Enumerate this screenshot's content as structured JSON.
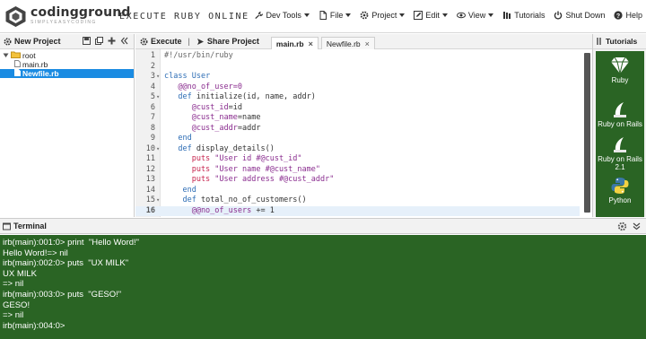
{
  "header": {
    "brand": "codingground",
    "brand_sub": "SIMPLYEASYCODING",
    "tagline": "EXECUTE RUBY ONLINE",
    "nav": [
      {
        "label": "Dev Tools",
        "icon": "wrench-icon",
        "has_caret": true
      },
      {
        "label": "File",
        "icon": "file-icon",
        "has_caret": true
      },
      {
        "label": "Project",
        "icon": "gear-icon",
        "has_caret": true
      },
      {
        "label": "Edit",
        "icon": "pencil-icon",
        "has_caret": true
      },
      {
        "label": "View",
        "icon": "eye-icon",
        "has_caret": true
      },
      {
        "label": "Tutorials",
        "icon": "tutorials-icon",
        "has_caret": false
      },
      {
        "label": "Shut Down",
        "icon": "power-icon",
        "has_caret": false
      },
      {
        "label": "Help",
        "icon": "help-icon",
        "has_caret": false
      }
    ]
  },
  "project": {
    "new_project_label": "New Project",
    "tree": [
      {
        "label": "root",
        "type": "folder",
        "depth": 0,
        "selected": false
      },
      {
        "label": "main.rb",
        "type": "file",
        "depth": 1,
        "selected": false
      },
      {
        "label": "Newfile.rb",
        "type": "file",
        "depth": 1,
        "selected": true
      }
    ]
  },
  "editor": {
    "execute_label": "Execute",
    "separator": "|",
    "share_label": "Share Project",
    "tabs": [
      {
        "label": "main.rb",
        "active": true
      },
      {
        "label": "Newfile.rb",
        "active": false
      }
    ],
    "active_line": 16,
    "lines": [
      {
        "n": "1",
        "fold": "",
        "tokens": [
          {
            "t": "#!/usr/bin/ruby",
            "c": "gray"
          }
        ]
      },
      {
        "n": "2",
        "fold": "",
        "tokens": []
      },
      {
        "n": "3",
        "fold": "▾",
        "tokens": [
          {
            "t": "class ",
            "c": "blue"
          },
          {
            "t": "User",
            "c": "blue"
          }
        ]
      },
      {
        "n": "4",
        "fold": "",
        "tokens": [
          {
            "t": "   @@no_of_user=0",
            "c": "purple"
          }
        ]
      },
      {
        "n": "5",
        "fold": "▾",
        "tokens": [
          {
            "t": "   def ",
            "c": "blue"
          },
          {
            "t": "initialize(id, name, addr)",
            "c": "dark"
          }
        ]
      },
      {
        "n": "6",
        "fold": "",
        "tokens": [
          {
            "t": "      @cust_id",
            "c": "purple"
          },
          {
            "t": "=id",
            "c": "dark"
          }
        ]
      },
      {
        "n": "7",
        "fold": "",
        "tokens": [
          {
            "t": "      @cust_name",
            "c": "purple"
          },
          {
            "t": "=name",
            "c": "dark"
          }
        ]
      },
      {
        "n": "8",
        "fold": "",
        "tokens": [
          {
            "t": "      @cust_addr",
            "c": "purple"
          },
          {
            "t": "=addr",
            "c": "dark"
          }
        ]
      },
      {
        "n": "9",
        "fold": "",
        "tokens": [
          {
            "t": "   end",
            "c": "blue"
          }
        ]
      },
      {
        "n": "10",
        "fold": "▾",
        "tokens": [
          {
            "t": "   def ",
            "c": "blue"
          },
          {
            "t": "display_details()",
            "c": "dark"
          }
        ]
      },
      {
        "n": "11",
        "fold": "",
        "tokens": [
          {
            "t": "      puts ",
            "c": "red"
          },
          {
            "t": "\"User id #@cust_id\"",
            "c": "purple"
          }
        ]
      },
      {
        "n": "12",
        "fold": "",
        "tokens": [
          {
            "t": "      puts ",
            "c": "red"
          },
          {
            "t": "\"User name #@cust_name\"",
            "c": "purple"
          }
        ]
      },
      {
        "n": "13",
        "fold": "",
        "tokens": [
          {
            "t": "      puts ",
            "c": "red"
          },
          {
            "t": "\"User address #@cust_addr\"",
            "c": "purple"
          }
        ]
      },
      {
        "n": "14",
        "fold": "",
        "tokens": [
          {
            "t": "    end",
            "c": "blue"
          }
        ]
      },
      {
        "n": "15",
        "fold": "▾",
        "tokens": [
          {
            "t": "    def ",
            "c": "blue"
          },
          {
            "t": "total_no_of_customers()",
            "c": "dark"
          }
        ]
      },
      {
        "n": "16",
        "fold": "",
        "tokens": [
          {
            "t": "      @@no_of_users",
            "c": "purple"
          },
          {
            "t": " += 1",
            "c": "dark"
          }
        ]
      }
    ]
  },
  "tutorials": {
    "title": "Tutorials",
    "items": [
      {
        "label": "Ruby",
        "icon": "ruby-gem-icon"
      },
      {
        "label": "Ruby on Rails",
        "icon": "rails-icon"
      },
      {
        "label": "Ruby on Rails 2.1",
        "icon": "rails-icon"
      },
      {
        "label": "Python",
        "icon": "python-icon"
      }
    ]
  },
  "terminal": {
    "title": "Terminal",
    "lines": [
      "irb(main):001:0> print  \"Hello Word!\"",
      "Hello Word!=> nil",
      "irb(main):002:0> puts  \"UX MILK\"",
      "UX MILK",
      "=> nil",
      "irb(main):003:0> puts  \"GESO!\"",
      "GESO!",
      "=> nil",
      "irb(main):004:0>"
    ]
  },
  "colors": {
    "terminal_bg": "#2a6424",
    "selected_row": "#1a8be2",
    "keyword": "#2d6db5",
    "variable": "#8a2d8f",
    "method_call": "#c7254e"
  }
}
